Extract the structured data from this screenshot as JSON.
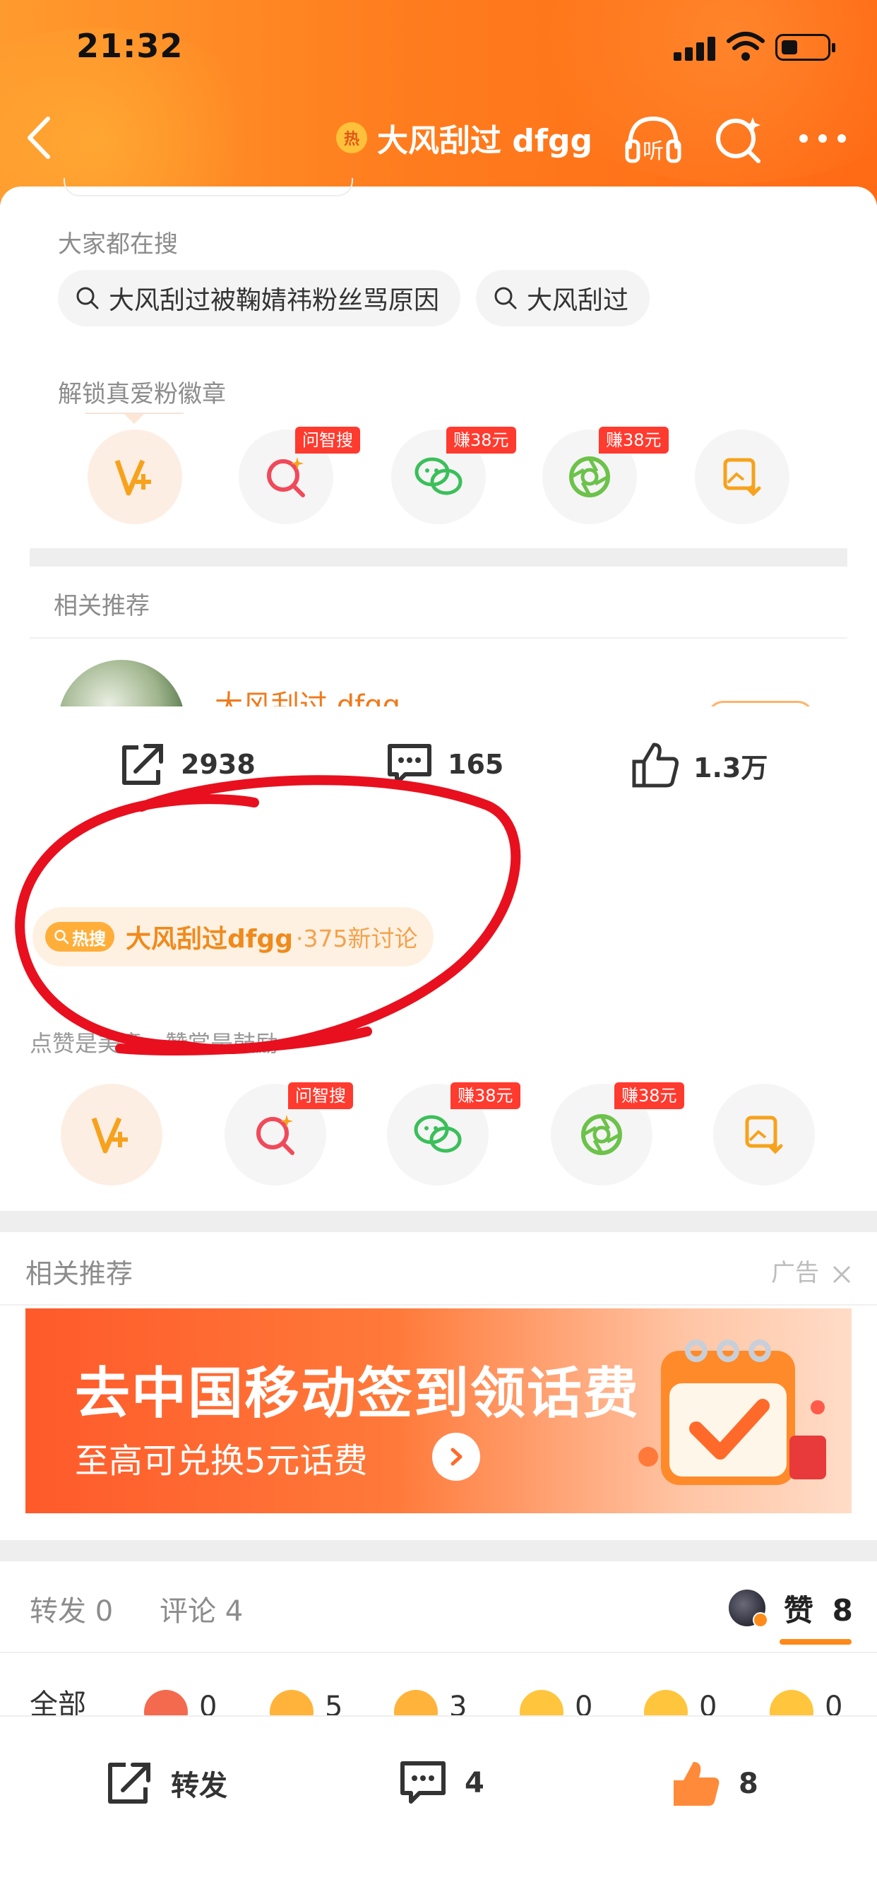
{
  "status_bar": {
    "time": "21:32"
  },
  "nav": {
    "hot_badge": "热",
    "title": "大风刮过 dfgg",
    "listen_label": "听"
  },
  "search_section": {
    "label": "大家都在搜",
    "chips": [
      "大风刮过被鞠婧祎粉丝骂原因",
      "大风刮过"
    ]
  },
  "badge_section": {
    "label": "解锁真爱粉徽章",
    "items": [
      {
        "icon": "vip-plus-icon",
        "tag": ""
      },
      {
        "icon": "ai-search-icon",
        "tag": "问智搜"
      },
      {
        "icon": "wechat-icon",
        "tag": "赚38元"
      },
      {
        "icon": "moments-icon",
        "tag": "赚38元"
      },
      {
        "icon": "save-image-icon",
        "tag": ""
      }
    ]
  },
  "related1": {
    "label": "相关推荐",
    "partial_title": "大风刮过 dfgg"
  },
  "stats": {
    "repost": "2938",
    "comments": "165",
    "likes": "1.3万"
  },
  "hot_search": {
    "tag": "热搜",
    "title": "大风刮过dfgg",
    "sub": "·375新讨论"
  },
  "reward_hint": "点赞是美意，赞赏是鼓励",
  "share_row": [
    {
      "icon": "vip-plus-icon",
      "tag": ""
    },
    {
      "icon": "ai-search-icon",
      "tag": "问智搜"
    },
    {
      "icon": "wechat-icon",
      "tag": "赚38元"
    },
    {
      "icon": "moments-icon",
      "tag": "赚38元"
    },
    {
      "icon": "save-image-icon",
      "tag": ""
    }
  ],
  "related2": {
    "label": "相关推荐",
    "ad_label": "广告"
  },
  "ad": {
    "title": "去中国移动签到领话费",
    "subtitle": "至高可兑换5元话费"
  },
  "tabs": {
    "repost": "转发 0",
    "comments": "评论 4",
    "likes_label": "赞",
    "likes_count": "8"
  },
  "reactions": [
    {
      "label": "全部",
      "count": ""
    },
    {
      "label": "",
      "count": "0",
      "color": "#f36a4e"
    },
    {
      "label": "",
      "count": "5",
      "color": "#ffb33a"
    },
    {
      "label": "",
      "count": "3",
      "color": "#ffb33a"
    },
    {
      "label": "",
      "count": "0",
      "color": "#ffc53d"
    },
    {
      "label": "",
      "count": "0",
      "color": "#ffc53d"
    },
    {
      "label": "",
      "count": "0",
      "color": "#ffc53d"
    }
  ],
  "bottom_bar": {
    "repost": "转发",
    "comments": "4",
    "likes": "8"
  },
  "colors": {
    "accent": "#ff7d1e",
    "hot_text": "#f08a1c",
    "annotation": "#e8101e",
    "tag_red": "#ff3a2e"
  }
}
